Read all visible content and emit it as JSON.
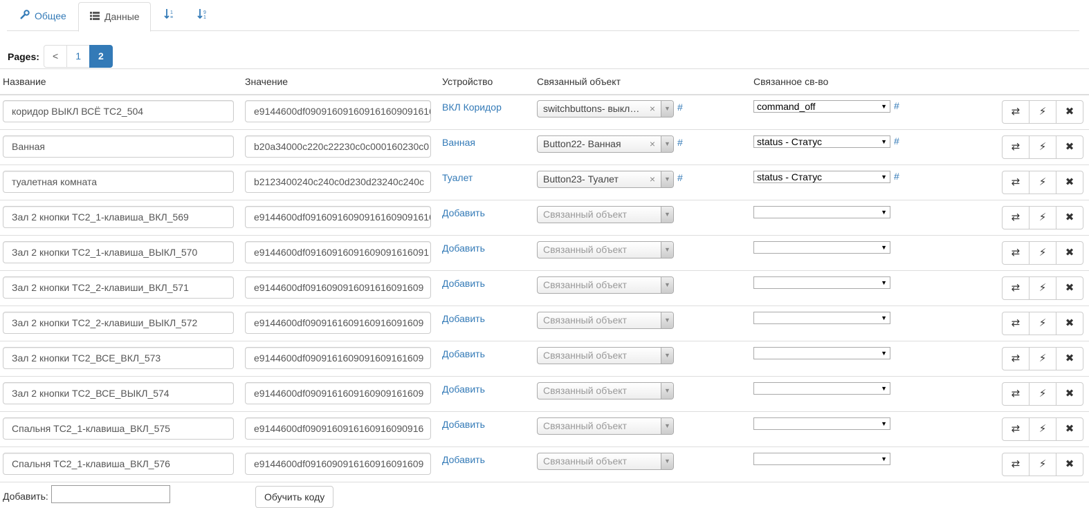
{
  "tabs": [
    {
      "label": "Общее",
      "icon": "wrench-icon",
      "glyph": "🔧"
    },
    {
      "label": "Данные",
      "icon": "list-icon",
      "glyph": "☰"
    },
    {
      "label": "",
      "icon": "sort-numeric-asc-icon",
      "glyph": "↓1"
    },
    {
      "label": "",
      "icon": "sort-numeric-desc-icon",
      "glyph": "↓9"
    }
  ],
  "pagination": {
    "label": "Pages:",
    "prev": "<",
    "pages": [
      "1",
      "2"
    ],
    "current": "2"
  },
  "columns": {
    "name": "Название",
    "value": "Значение",
    "device": "Устройство",
    "linked_object": "Связанный объект",
    "linked_property": "Связанное св-во"
  },
  "placeholder_linked_object": "Связанный объект",
  "hash": "#",
  "action_glyphs": {
    "refresh": "⇄",
    "run": "⚡",
    "delete": "✖"
  },
  "rows": [
    {
      "name": "коридор ВЫКЛ ВСЁ ТС2_504",
      "value": "e9144600df090916091609161609091616",
      "device": "ВКЛ Коридор",
      "linked_object": "switchbuttons- выкл…",
      "linked_property": "command_off"
    },
    {
      "name": "Ванная",
      "value": "b20a34000c220c22230c0c000160230c0",
      "device": "Ванная",
      "linked_object": "Button22- Ванная",
      "linked_property": "status - Статус"
    },
    {
      "name": "туалетная комната",
      "value": "b2123400240c240c0d230d23240c240c",
      "device": "Туалет",
      "linked_object": "Button23- Туалет",
      "linked_property": "status - Статус"
    },
    {
      "name": "Зал 2 кнопки ТС2_1-клавиша_ВКЛ_569",
      "value": "e9144600df091609160909161609091616",
      "device": "Добавить",
      "linked_object": "",
      "linked_property": ""
    },
    {
      "name": "Зал 2 кнопки ТС2_1-клавиша_ВЫКЛ_570",
      "value": "e9144600df09160916091609091616091",
      "device": "Добавить",
      "linked_object": "",
      "linked_property": ""
    },
    {
      "name": "Зал 2 кнопки ТС2_2-клавиши_ВКЛ_571",
      "value": "e9144600df0916090916091616091609",
      "device": "Добавить",
      "linked_object": "",
      "linked_property": ""
    },
    {
      "name": "Зал 2 кнопки ТС2_2-клавиши_ВЫКЛ_572",
      "value": "e9144600df0909161609160916091609",
      "device": "Добавить",
      "linked_object": "",
      "linked_property": ""
    },
    {
      "name": "Зал 2 кнопки ТС2_ВСЕ_ВКЛ_573",
      "value": "e9144600df0909161609091609161609",
      "device": "Добавить",
      "linked_object": "",
      "linked_property": ""
    },
    {
      "name": "Зал 2 кнопки ТС2_ВСЕ_ВЫКЛ_574",
      "value": "e9144600df0909161609160909161609",
      "device": "Добавить",
      "linked_object": "",
      "linked_property": ""
    },
    {
      "name": "Спальня ТС2_1-клавиша_ВКЛ_575",
      "value": "e9144600df0909160916160916090916",
      "device": "Добавить",
      "linked_object": "",
      "linked_property": ""
    },
    {
      "name": "Спальня ТС2_1-клавиша_ВКЛ_576",
      "value": "e9144600df0916090916160916091609",
      "device": "Добавить",
      "linked_object": "",
      "linked_property": ""
    }
  ],
  "footer": {
    "add_label": "Добавить:",
    "train_button": "Обучить коду"
  }
}
